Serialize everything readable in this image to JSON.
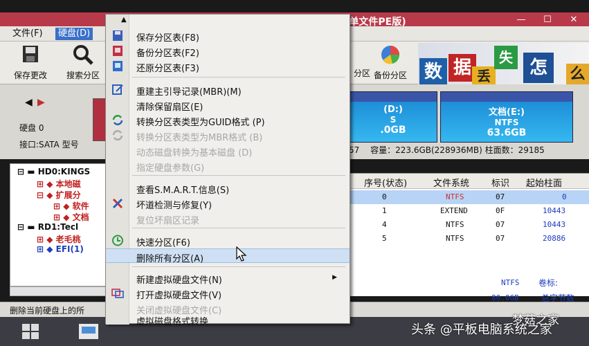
{
  "window": {
    "title_visible": "赓版(单文件PE版)"
  },
  "menubar": {
    "items": [
      "文件(F)",
      "硬盘(D)"
    ]
  },
  "toolbar": {
    "save": "保存更改",
    "search": "搜索分区",
    "part_fragment": "分区",
    "backup": "备份分区"
  },
  "banner": {
    "tiles": [
      "数",
      "据",
      "丢",
      "失",
      "怎",
      "么"
    ]
  },
  "disk": {
    "label": "硬盘 0",
    "interface": "接口:SATA  型号",
    "part_d": {
      "name": "(D:)",
      "fs": "S",
      "size": ".0GB"
    },
    "part_e": {
      "name": "文档(E:)",
      "fs": "NTFS",
      "size": "63.6GB"
    },
    "info_prefix": "57",
    "info": "容量：223.6GB(228936MB)   柱面数：29185"
  },
  "tree": {
    "nodes": [
      "HD0:KINGS",
      "本地磁",
      "扩展分",
      "软件",
      "文档",
      "RD1:Tecl",
      "老毛桃",
      "EFI(1)"
    ]
  },
  "table": {
    "headers": [
      "序号(状态)",
      "文件系统",
      "标识",
      "起始柱面"
    ],
    "rows": [
      {
        "idx": "0",
        "fs": "NTFS",
        "flag": "07",
        "start": "0"
      },
      {
        "idx": "1",
        "fs": "EXTEND",
        "flag": "0F",
        "start": "10443"
      },
      {
        "idx": "4",
        "fs": "NTFS",
        "flag": "07",
        "start": "10443"
      },
      {
        "idx": "5",
        "fs": "NTFS",
        "flag": "07",
        "start": "20886"
      }
    ],
    "detail_fs": "NTFS",
    "detail_label": "卷标:",
    "detail_size": "80.0GB",
    "detail_total": "总字节数"
  },
  "statusbar": {
    "text": "删除当前硬盘上的所"
  },
  "context_menu": {
    "items": [
      {
        "label": "保存分区表(F8)",
        "enabled": true
      },
      {
        "label": "备份分区表(F2)",
        "enabled": true
      },
      {
        "label": "还原分区表(F3)",
        "enabled": true
      },
      {
        "label": "重建主引导记录(MBR)(M)",
        "enabled": true
      },
      {
        "label": "清除保留扇区(E)",
        "enabled": true
      },
      {
        "label": "转换分区表类型为GUID格式 (P)",
        "enabled": true
      },
      {
        "label": "转换分区表类型为MBR格式 (B)",
        "enabled": false
      },
      {
        "label": "动态磁盘转换为基本磁盘 (D)",
        "enabled": false
      },
      {
        "label": "指定硬盘参数(G)",
        "enabled": false
      },
      {
        "label": "查看S.M.A.R.T.信息(S)",
        "enabled": true
      },
      {
        "label": "坏道检测与修复(Y)",
        "enabled": true
      },
      {
        "label": "复位坏扇区记录",
        "enabled": false
      },
      {
        "label": "快速分区(F6)",
        "enabled": true
      },
      {
        "label": "删除所有分区(A)",
        "enabled": true
      },
      {
        "label": "新建虚拟硬盘文件(N)",
        "enabled": true
      },
      {
        "label": "打开虚拟硬盘文件(V)",
        "enabled": true
      },
      {
        "label": "关闭虚拟硬盘文件(C)",
        "enabled": false
      },
      {
        "label": "虚拟磁盘格式转换",
        "enabled": true
      }
    ]
  },
  "watermark": {
    "line1": "梦菇之家",
    "line2": "头条 @平板电脑系统之家"
  },
  "colors": {
    "titlebar": "#b83a4a",
    "menu_active": "#3a70c8",
    "part_fill": "#1e8fd8"
  }
}
